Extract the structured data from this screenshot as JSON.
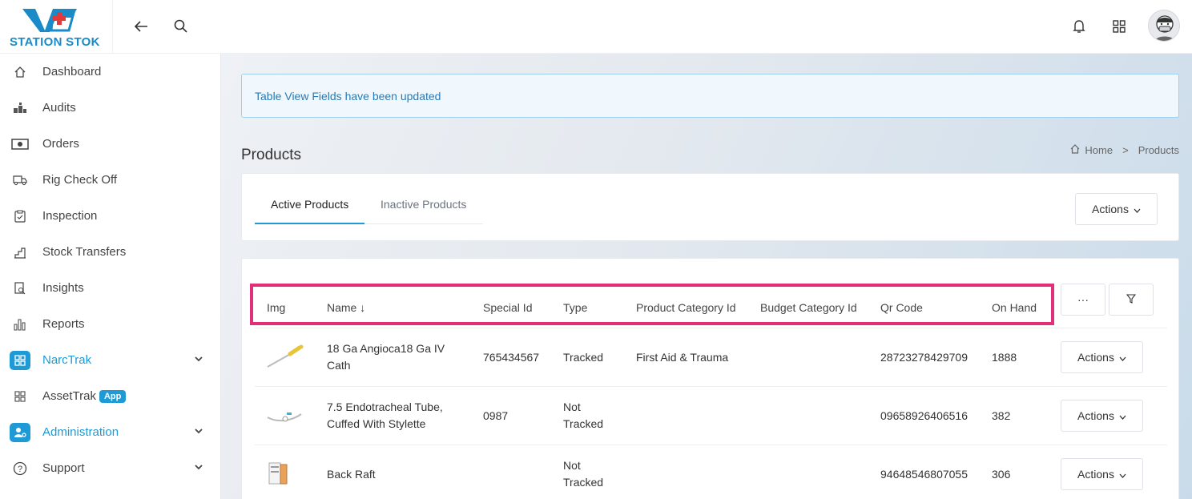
{
  "brand": {
    "name": "STATION STOK"
  },
  "sidebar": {
    "items": [
      {
        "label": "Dashboard",
        "icon": "home-icon"
      },
      {
        "label": "Audits",
        "icon": "boxes-icon"
      },
      {
        "label": "Orders",
        "icon": "money-icon"
      },
      {
        "label": "Rig Check Off",
        "icon": "truck-icon"
      },
      {
        "label": "Inspection",
        "icon": "clipboard-check-icon"
      },
      {
        "label": "Stock Transfers",
        "icon": "chart-steps-icon"
      },
      {
        "label": "Insights",
        "icon": "document-search-icon"
      },
      {
        "label": "Reports",
        "icon": "bar-chart-icon"
      },
      {
        "label": "NarcTrak",
        "icon": "grid-icon"
      },
      {
        "label": "AssetTrak",
        "icon": "grid-icon",
        "badge": "App"
      },
      {
        "label": "Administration",
        "icon": "user-gear-icon"
      },
      {
        "label": "Support",
        "icon": "question-icon"
      }
    ]
  },
  "alert": {
    "text": "Table View Fields have been updated"
  },
  "page": {
    "title": "Products"
  },
  "breadcrumb": {
    "home": "Home",
    "separator": ">",
    "current": "Products"
  },
  "tabs": {
    "active": "Active Products",
    "inactive": "Inactive Products",
    "actions": "Actions"
  },
  "table": {
    "headers": {
      "img": "Img",
      "name": "Name ↓",
      "special_id": "Special Id",
      "type": "Type",
      "product_category": "Product Category Id",
      "budget_category": "Budget Category Id",
      "qr_code": "Qr Code",
      "on_hand": "On Hand"
    },
    "more_label": "···",
    "rows": [
      {
        "name_1": "18 Ga Angioca18 Ga IV",
        "name_2": "Cath",
        "special_id": "765434567",
        "type_1": "Tracked",
        "type_2": "",
        "product_category": "First Aid & Trauma",
        "budget_category": "",
        "qr_code": "28723278429709",
        "on_hand": "1888",
        "action": "Actions"
      },
      {
        "name_1": "7.5 Endotracheal Tube,",
        "name_2": "Cuffed With Stylette",
        "special_id": "0987",
        "type_1": "Not",
        "type_2": "Tracked",
        "product_category": "",
        "budget_category": "",
        "qr_code": "09658926406516",
        "on_hand": "382",
        "action": "Actions"
      },
      {
        "name_1": "Back Raft",
        "name_2": "",
        "special_id": "",
        "type_1": "Not",
        "type_2": "Tracked",
        "product_category": "",
        "budget_category": "",
        "qr_code": "94648546807055",
        "on_hand": "306",
        "action": "Actions"
      }
    ]
  },
  "colors": {
    "accent": "#1e9bd7",
    "highlight": "#e0307a",
    "alert_bg": "#f0f8fd"
  }
}
